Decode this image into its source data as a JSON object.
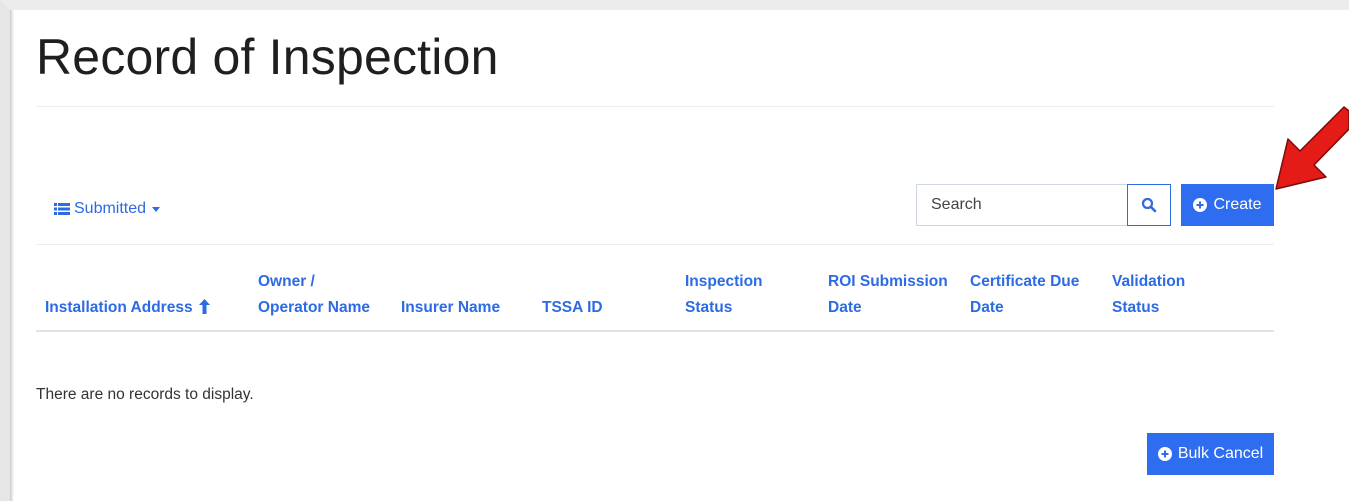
{
  "page": {
    "title": "Record of Inspection"
  },
  "toolbar": {
    "view_label": "Submitted",
    "search_placeholder": "Search",
    "create_label": "Create",
    "bulk_cancel_label": "Bulk Cancel"
  },
  "table": {
    "columns": [
      {
        "line1": "",
        "line2": "Installation Address",
        "sorted": "asc"
      },
      {
        "line1": "Owner /",
        "line2": "Operator Name"
      },
      {
        "line1": "",
        "line2": "Insurer Name"
      },
      {
        "line1": "",
        "line2": "TSSA ID"
      },
      {
        "line1": "Inspection",
        "line2": "Status"
      },
      {
        "line1": "ROI Submission",
        "line2": "Date"
      },
      {
        "line1": "Certificate Due",
        "line2": "Date"
      },
      {
        "line1": "Validation",
        "line2": "Status"
      }
    ],
    "empty_message": "There are no records to display."
  },
  "icons": {
    "view": "list-icon",
    "search": "search-icon",
    "create": "plus-circle-icon",
    "bulk_cancel": "plus-circle-icon",
    "sort": "sort-ascending-icon",
    "annotation": "red-arrow-icon"
  },
  "colors": {
    "accent": "#2f6df0",
    "link": "#2d6be4",
    "annotation_arrow": "#e41b17"
  }
}
